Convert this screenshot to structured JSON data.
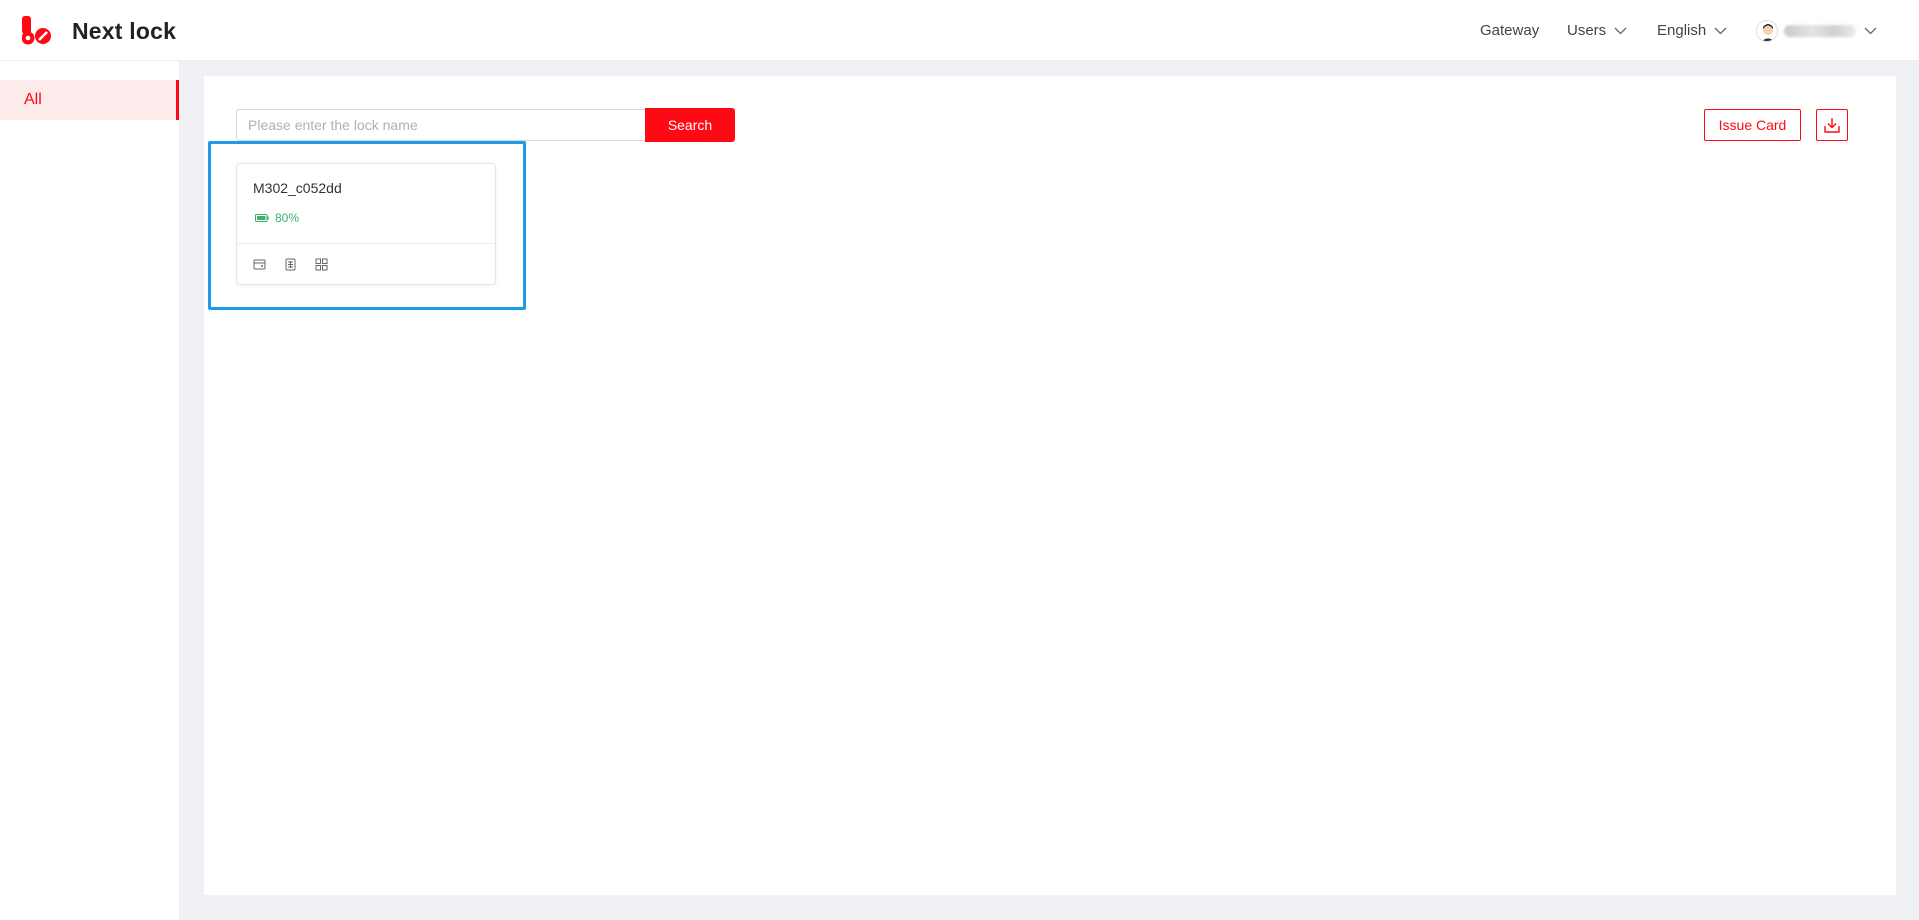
{
  "header": {
    "brand": "Next lock",
    "nav": {
      "gateway": "Gateway",
      "users": "Users",
      "language": "English"
    }
  },
  "sidebar": {
    "items": [
      {
        "label": "All",
        "active": true
      }
    ]
  },
  "toolbar": {
    "search_placeholder": "Please enter the lock name",
    "search_label": "Search",
    "issue_card_label": "Issue Card"
  },
  "locks": [
    {
      "name": "M302_c052dd",
      "battery": "80%"
    }
  ],
  "colors": {
    "accent": "#ff0a14",
    "battery_ok": "#3cb371",
    "highlight": "#1e9be6"
  },
  "icons": {
    "download": "download-icon",
    "chevron": "chevron-down-icon",
    "battery": "battery-icon"
  }
}
